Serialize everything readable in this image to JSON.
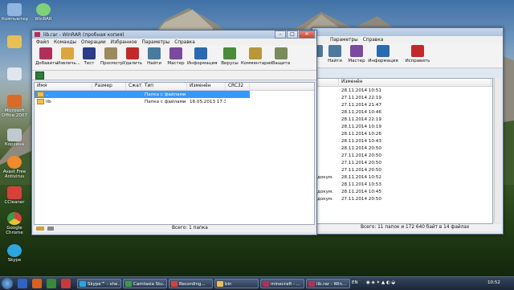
{
  "desktop_icons": [
    {
      "label": "Компьютер",
      "color": "#8fb5e0"
    },
    {
      "label": "WinRAR",
      "color": "#7fd07a"
    },
    {
      "label": "Корзина",
      "color": "#c0c8d0"
    },
    {
      "label": "Avast Free Antivirus",
      "color": "#f08a2a"
    },
    {
      "label": "CCleaner",
      "color": "#d8403a"
    },
    {
      "label": "Google Chrome",
      "color": "#e8c030"
    },
    {
      "label": "Skype",
      "color": "#2ba6e0"
    },
    {
      "label": "Microsoft Office 2007",
      "color": "#d86a2a"
    }
  ],
  "back_window": {
    "menu": [
      "Параметры",
      "Справка"
    ],
    "toolbar": [
      "Найти",
      "Мастер",
      "Информация",
      "Исправить"
    ],
    "column_header": "Изменён",
    "dates": [
      "28.11.2014 10:51",
      "27.11.2014 22:19",
      "27.11.2014 21:47",
      "28.11.2014 10:46",
      "28.11.2014 22:19",
      "28.11.2014 10:19",
      "28.11.2014 10:26",
      "28.11.2014 10:43",
      "28.11.2014 20:50",
      "27.11.2014 20:50",
      "27.11.2014 20:50",
      "27.11.2014 20:50",
      "28.11.2014 10:52",
      "28.11.2014 10:53",
      "28.11.2014 10:45",
      "27.11.2014 20:50"
    ],
    "prefixes": [
      "",
      "",
      "",
      "",
      "",
      "",
      "",
      "",
      "",
      "",
      "",
      "",
      "докум.",
      "",
      "докум.",
      "докум."
    ],
    "status": "Всего: 11 папок и 172 640 байт в 14 файлах"
  },
  "front_window": {
    "title": "lib.rar - WinRAR (пробная копия)",
    "menu": [
      "Файл",
      "Команды",
      "Операции",
      "Избранное",
      "Параметры",
      "Справка"
    ],
    "toolbar": [
      {
        "label": "Добавить",
        "icon": "add-icon",
        "color": "#b0305a"
      },
      {
        "label": "Извлечь...",
        "icon": "extract-icon",
        "color": "#d9a640"
      },
      {
        "label": "Тест",
        "icon": "test-icon",
        "color": "#2a3c8a"
      },
      {
        "label": "Просмотр",
        "icon": "view-icon",
        "color": "#9b8a60"
      },
      {
        "label": "Удалить",
        "icon": "delete-icon",
        "color": "#c02a2a"
      },
      {
        "label": "Найти",
        "icon": "find-icon",
        "color": "#4a7a9e"
      },
      {
        "label": "Мастер",
        "icon": "wizard-icon",
        "color": "#7a4a9e"
      },
      {
        "label": "Информация",
        "icon": "info-icon",
        "color": "#2a6ab0"
      },
      {
        "label": "Вирусы",
        "icon": "virus-icon",
        "color": "#4a8a3a"
      },
      {
        "label": "Комментарий",
        "icon": "comment-icon",
        "color": "#b8963a"
      },
      {
        "label": "Защита",
        "icon": "protect-icon",
        "color": "#7a8a5a"
      }
    ],
    "columns": [
      "Имя",
      "Размер",
      "Сжат",
      "Тип",
      "Изменён",
      "CRC32"
    ],
    "rows": [
      {
        "name": "..",
        "size": "",
        "packed": "",
        "type": "Папка с файлами",
        "modified": "",
        "crc": ""
      },
      {
        "name": "lib",
        "size": "",
        "packed": "",
        "type": "Папка с файлами",
        "modified": "18.05.2013 17:30",
        "crc": ""
      }
    ],
    "status": "Всего: 1 папка"
  },
  "taskbar": {
    "pins": [
      "#2f64c4",
      "#d86020",
      "#3a8a3a",
      "#c83a3a"
    ],
    "buttons": [
      {
        "label": "Skype™ - she...",
        "color": "#2ba6e0"
      },
      {
        "label": "Camtasia Stu...",
        "color": "#3a9a4a"
      },
      {
        "label": "Recording...",
        "color": "#d8403a"
      },
      {
        "label": "bin",
        "color": "#e8c056"
      },
      {
        "label": "minecraft - ...",
        "color": "#b0305a"
      },
      {
        "label": "lib.rar - Win...",
        "color": "#b0305a"
      }
    ],
    "lang": "EN",
    "time": "10:52"
  }
}
